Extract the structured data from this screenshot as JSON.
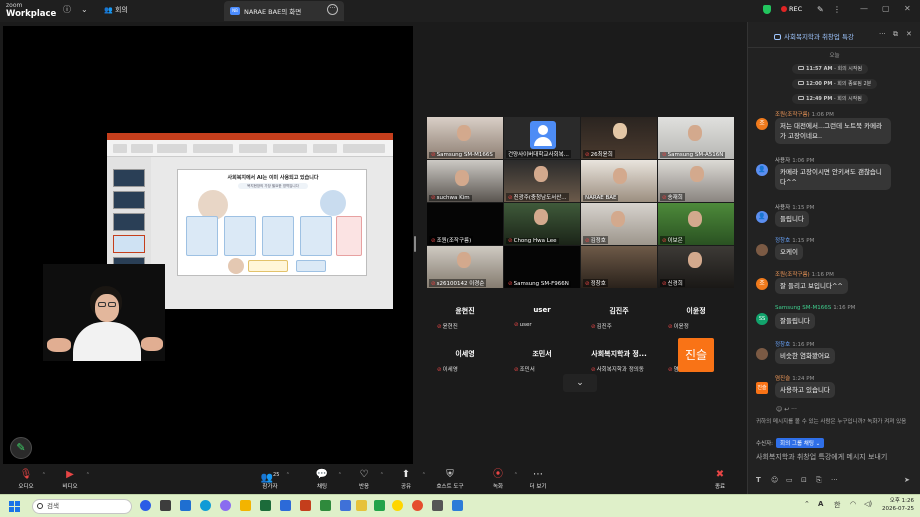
{
  "app": {
    "logo_line1": "zoom",
    "logo_line2": "Workplace",
    "meeting_label": "회의",
    "rec_label": "REC"
  },
  "tab": {
    "badge": "NB",
    "title": "NARAE BAE의 화면"
  },
  "slide": {
    "title": "사회복지에서 AI는 이미 사용되고 있습니다",
    "subtitle": "복지현장의 가장 필요한 영역입니다"
  },
  "gallery": {
    "tiles": [
      {
        "name": "Samsung SM-M166S"
      },
      {
        "name": "건양사이버대학교사회복..."
      },
      {
        "name": "26최윤희"
      },
      {
        "name": "Samsung SM-A516N"
      },
      {
        "name": "suchwa Kim"
      },
      {
        "name": "진광주(충청남도서산..."
      },
      {
        "name": "NARAE BAE"
      },
      {
        "name": "송재희"
      },
      {
        "name": "조원(조작구름)"
      },
      {
        "name": "Chong Hwa Lee"
      },
      {
        "name": "김정호"
      },
      {
        "name": "이보은"
      },
      {
        "name": "s26100142 이경순"
      },
      {
        "name": "Samsung SM-F966N"
      },
      {
        "name": "정창호"
      },
      {
        "name": "신경희"
      }
    ],
    "no_video": [
      {
        "name": "윤현진",
        "label": "윤현진"
      },
      {
        "name": "user",
        "label": "user"
      },
      {
        "name": "김진주",
        "label": "김진주"
      },
      {
        "name": "이윤정",
        "label": "이윤정"
      },
      {
        "name": "이세영",
        "label": "이세영"
      },
      {
        "name": "조민서",
        "label": "조민서"
      },
      {
        "name": "사회복지학과 정...",
        "label": "사회복지학과 정의동"
      },
      {
        "name": "",
        "label": "염진슬"
      }
    ],
    "jinseul_avatar": "진슬"
  },
  "chat": {
    "title": "사회복지학과 취창업 특강",
    "today": "오늘",
    "system": [
      {
        "time": "11:57 AM",
        "text": "- 회의 시작됨"
      },
      {
        "time": "12:00 PM",
        "text": "- 회의 종료됨 2분"
      },
      {
        "time": "12:49 PM",
        "text": "- 회의 시작됨"
      }
    ],
    "messages": [
      {
        "sender": "조원(조작구름)",
        "time": "1:06 PM",
        "text": "저는 대전에서...그런데 노트북 카메라가 고장이네요..",
        "avatar": "조",
        "color": "#f07a1c"
      },
      {
        "sender": "사용자",
        "time": "1:06 PM",
        "text": "카메라 고장이시면 안키셔도 괜찮습니다^^",
        "avatar": "",
        "color": "#5b8ef0"
      },
      {
        "sender": "사용자",
        "time": "1:15 PM",
        "text": "들립니다",
        "avatar": "",
        "color": "#5b8ef0"
      },
      {
        "sender": "정창호",
        "time": "1:15 PM",
        "text": "오케이",
        "avatar": "",
        "color": "#7b5a44"
      },
      {
        "sender": "조원(조작구름)",
        "time": "1:16 PM",
        "text": "잘 들리고 보입니다^^",
        "avatar": "조",
        "color": "#f07a1c"
      },
      {
        "sender": "Samsung SM-M166S",
        "time": "1:16 PM",
        "text": "잘들립니다",
        "avatar": "SS",
        "color": "#12a36c"
      },
      {
        "sender": "정창호",
        "time": "1:16 PM",
        "text": "비슷한 염화봤어요",
        "avatar": "",
        "color": "#7b5a44"
      },
      {
        "sender": "염진슬",
        "time": "1:24 PM",
        "text": "사용하고 있습니다",
        "avatar": "진슬",
        "color": "#f97316"
      }
    ],
    "notice": "귀하의 메시지를 볼 수 있는 사람은 누구입니까? 녹화가 켜져 있음",
    "recipient_label": "수신자:",
    "recipient": "회의 그룹 채팅",
    "placeholder": "사회복지학과 취창업 특강에게 메시지 보내기"
  },
  "toolbar": {
    "audio": "오디오",
    "video": "비디오",
    "participants": "참가자",
    "participants_count": "25",
    "chat": "채팅",
    "react": "반응",
    "share": "공유",
    "host_tools": "호스트 도구",
    "record": "녹화",
    "more": "더 보기",
    "end": "종료"
  },
  "taskbar": {
    "search": "검색",
    "ime": "한",
    "time": "오후 1:26",
    "date": "2026-07-25"
  }
}
